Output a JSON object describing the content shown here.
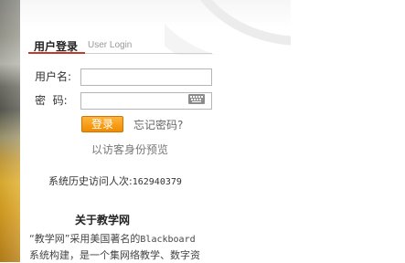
{
  "login": {
    "title": "用户登录",
    "subtitle": "User Login",
    "username_label": "用户名:",
    "password_label": "密  码:",
    "username_value": "",
    "password_value": "",
    "login_button": "登录",
    "forgot_password": "忘记密码?",
    "guest_preview": "以访客身份预览"
  },
  "stats": {
    "visit_label": "系统历史访问人次:",
    "visit_count": "162940379"
  },
  "about": {
    "heading": "关于教学网",
    "line1_prefix": "“教学网”采用美国著名的",
    "line1_brand": "Blackboard",
    "line2": "系统构建，是一个集网络教学、数字资"
  },
  "icons": {
    "keyboard": "keyboard-icon"
  },
  "colors": {
    "accent": "#c23a2a",
    "button": "#f39a10"
  }
}
